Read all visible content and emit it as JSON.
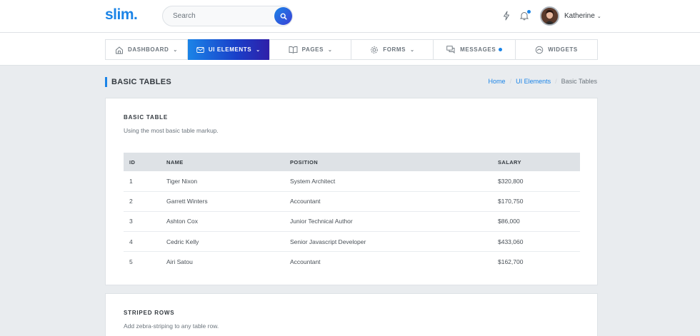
{
  "header": {
    "logo": "slim.",
    "search_placeholder": "Search",
    "username": "Katherine"
  },
  "nav": [
    {
      "label": "DASHBOARD",
      "icon": "home-icon",
      "chevron": true,
      "active": false
    },
    {
      "label": "UI ELEMENTS",
      "icon": "envelope-icon",
      "chevron": true,
      "active": true
    },
    {
      "label": "PAGES",
      "icon": "book-icon",
      "chevron": true,
      "active": false
    },
    {
      "label": "FORMS",
      "icon": "gear-icon",
      "chevron": true,
      "active": false
    },
    {
      "label": "MESSAGES",
      "icon": "chat-icon",
      "dot": true,
      "active": false
    },
    {
      "label": "WIDGETS",
      "icon": "gauge-icon",
      "active": false
    }
  ],
  "page": {
    "title": "BASIC TABLES",
    "breadcrumb": [
      "Home",
      "UI Elements",
      "Basic Tables"
    ]
  },
  "basic_table": {
    "title": "BASIC TABLE",
    "subtitle": "Using the most basic table markup.",
    "columns": [
      "ID",
      "NAME",
      "POSITION",
      "SALARY"
    ],
    "rows": [
      [
        "1",
        "Tiger Nixon",
        "System Architect",
        "$320,800"
      ],
      [
        "2",
        "Garrett Winters",
        "Accountant",
        "$170,750"
      ],
      [
        "3",
        "Ashton Cox",
        "Junior Technical Author",
        "$86,000"
      ],
      [
        "4",
        "Cedric Kelly",
        "Senior Javascript Developer",
        "$433,060"
      ],
      [
        "5",
        "Airi Satou",
        "Accountant",
        "$162,700"
      ]
    ]
  },
  "striped_table": {
    "title": "STRIPED ROWS",
    "subtitle": "Add zebra-striping to any table row."
  },
  "colors": {
    "accent": "#1b84e7",
    "active_nav_start": "#1b84e7",
    "active_nav_end": "#2f1fa8"
  }
}
